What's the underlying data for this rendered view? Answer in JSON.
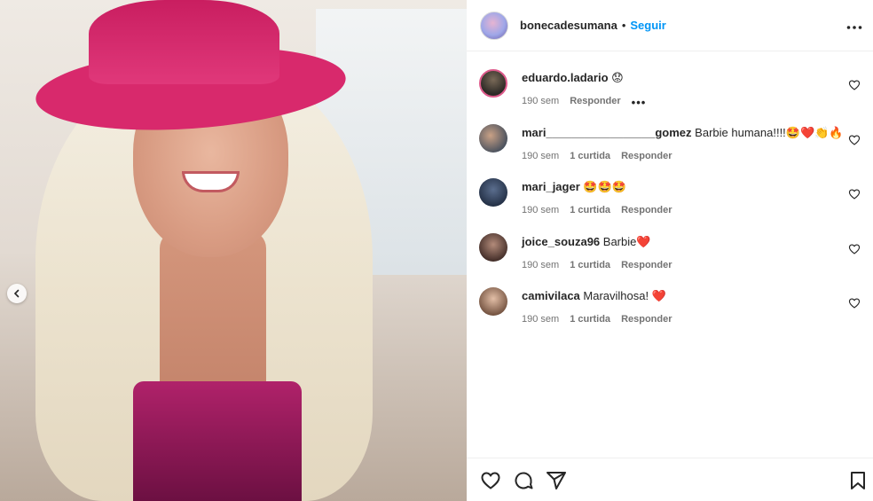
{
  "post": {
    "username": "bonecadesumana",
    "dot": "•",
    "follow_label": "Seguir",
    "more_label": "•••"
  },
  "comments": [
    {
      "user": "eduardo.ladario",
      "text": "😟",
      "time": "190 sem",
      "likes": "",
      "reply": "Responder",
      "options": "•••"
    },
    {
      "user": "mari_________________gomez",
      "text": "Barbie humana!!!!🤩❤️👏🔥",
      "time": "190 sem",
      "likes": "1 curtida",
      "reply": "Responder"
    },
    {
      "user": "mari_jager",
      "text": "🤩🤩🤩",
      "time": "190 sem",
      "likes": "1 curtida",
      "reply": "Responder"
    },
    {
      "user": "joice_souza96",
      "text": "Barbie❤️",
      "time": "190 sem",
      "likes": "1 curtida",
      "reply": "Responder"
    },
    {
      "user": "camivilaca",
      "text": "Maravilhosa! ❤️",
      "time": "190 sem",
      "likes": "1 curtida",
      "reply": "Responder"
    }
  ],
  "icons": {
    "carousel_prev": "chevron-left-icon",
    "like": "heart-icon",
    "comment": "comment-icon",
    "share": "send-icon",
    "save": "bookmark-icon"
  },
  "colors": {
    "accent": "#0095f6",
    "hat": "#d8296c",
    "text": "#262626",
    "muted": "#737373"
  }
}
